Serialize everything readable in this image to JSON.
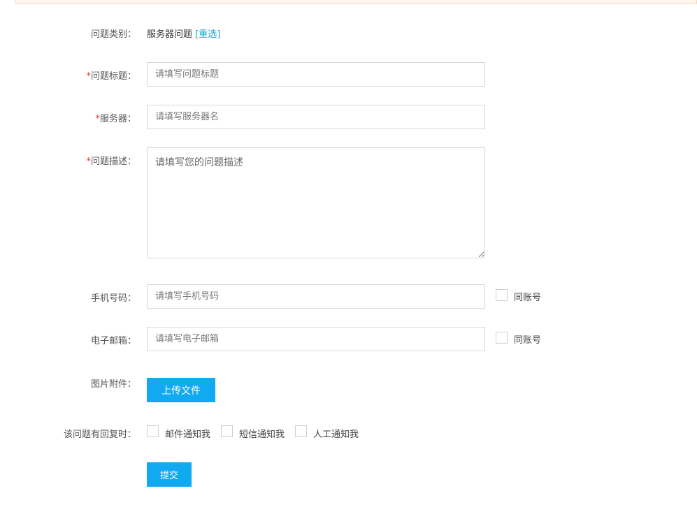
{
  "form": {
    "category": {
      "label": "问题类别：",
      "value": "服务器问题",
      "reselect": "[重选]"
    },
    "title": {
      "required_mark": "*",
      "label": "问题标题：",
      "placeholder": "请填写问题标题"
    },
    "server": {
      "required_mark": "*",
      "label": "服务器：",
      "placeholder": "请填写服务器名"
    },
    "description": {
      "required_mark": "*",
      "label": "问题描述：",
      "placeholder": "请填写您的问题描述"
    },
    "phone": {
      "label": "手机号码：",
      "placeholder": "请填写手机号码",
      "same_account": "同账号"
    },
    "email": {
      "label": "电子邮箱：",
      "placeholder": "请填写电子邮箱",
      "same_account": "同账号"
    },
    "attachment": {
      "label": "图片附件：",
      "upload_button": "上传文件"
    },
    "notify": {
      "label": "该问题有回复时：",
      "options": [
        "邮件通知我",
        "短信通知我",
        "人工通知我"
      ]
    },
    "submit": "提交"
  },
  "colors": {
    "accent": "#11a9f0",
    "required": "#e4393c",
    "link": "#1a9ed6",
    "banner_bg": "#fff7ee",
    "banner_border": "#f7d9bd"
  }
}
